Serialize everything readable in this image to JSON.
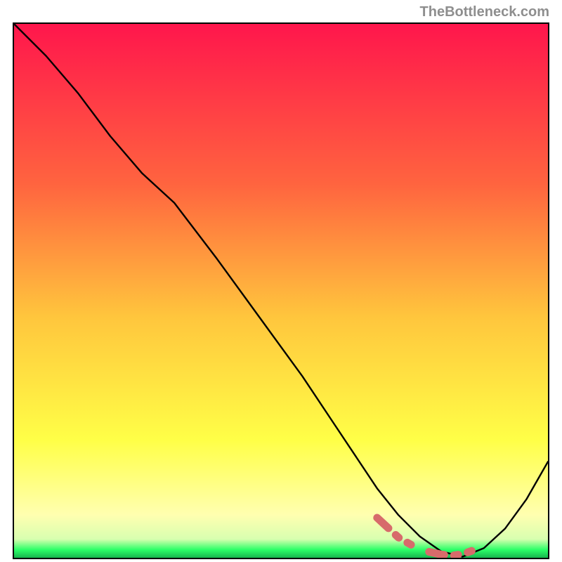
{
  "watermark": "TheBottleneck.com",
  "colors": {
    "gradient_top": "#ff164c",
    "gradient_mid_upper": "#ff8d3f",
    "gradient_mid_lower": "#ffe43d",
    "gradient_pale": "#ffffa0",
    "gradient_green": "#2bff67",
    "curve": "#000000",
    "dash": "#d76b6b"
  },
  "chart_data": {
    "type": "line",
    "title": "",
    "xlabel": "",
    "ylabel": "",
    "xlim": [
      0,
      100
    ],
    "ylim": [
      0,
      100
    ],
    "grid": false,
    "legend": false,
    "series": [
      {
        "name": "bottleneck-curve",
        "x": [
          0,
          6,
          12,
          18,
          24,
          30,
          38,
          46,
          54,
          60,
          64,
          68,
          72,
          76,
          80,
          84,
          88,
          92,
          96,
          100
        ],
        "y": [
          100,
          94,
          87,
          79,
          72,
          66.5,
          56,
          45,
          34,
          25,
          19,
          13,
          8,
          4,
          1.2,
          0.2,
          1.8,
          5.5,
          11,
          18
        ]
      },
      {
        "name": "optimal-band",
        "x": [
          68,
          72,
          76,
          80,
          82,
          84,
          86
        ],
        "y": [
          7.5,
          3.8,
          1.5,
          0.6,
          0.4,
          0.7,
          1.4
        ]
      }
    ],
    "gradient_stops": [
      {
        "offset": 0,
        "color": "#ff164c"
      },
      {
        "offset": 0.3,
        "color": "#ff643f"
      },
      {
        "offset": 0.55,
        "color": "#ffc63d"
      },
      {
        "offset": 0.78,
        "color": "#ffff47"
      },
      {
        "offset": 0.92,
        "color": "#ffffb0"
      },
      {
        "offset": 0.965,
        "color": "#d8ffb0"
      },
      {
        "offset": 0.985,
        "color": "#2bff67"
      },
      {
        "offset": 1.0,
        "color": "#17b54f"
      }
    ]
  }
}
